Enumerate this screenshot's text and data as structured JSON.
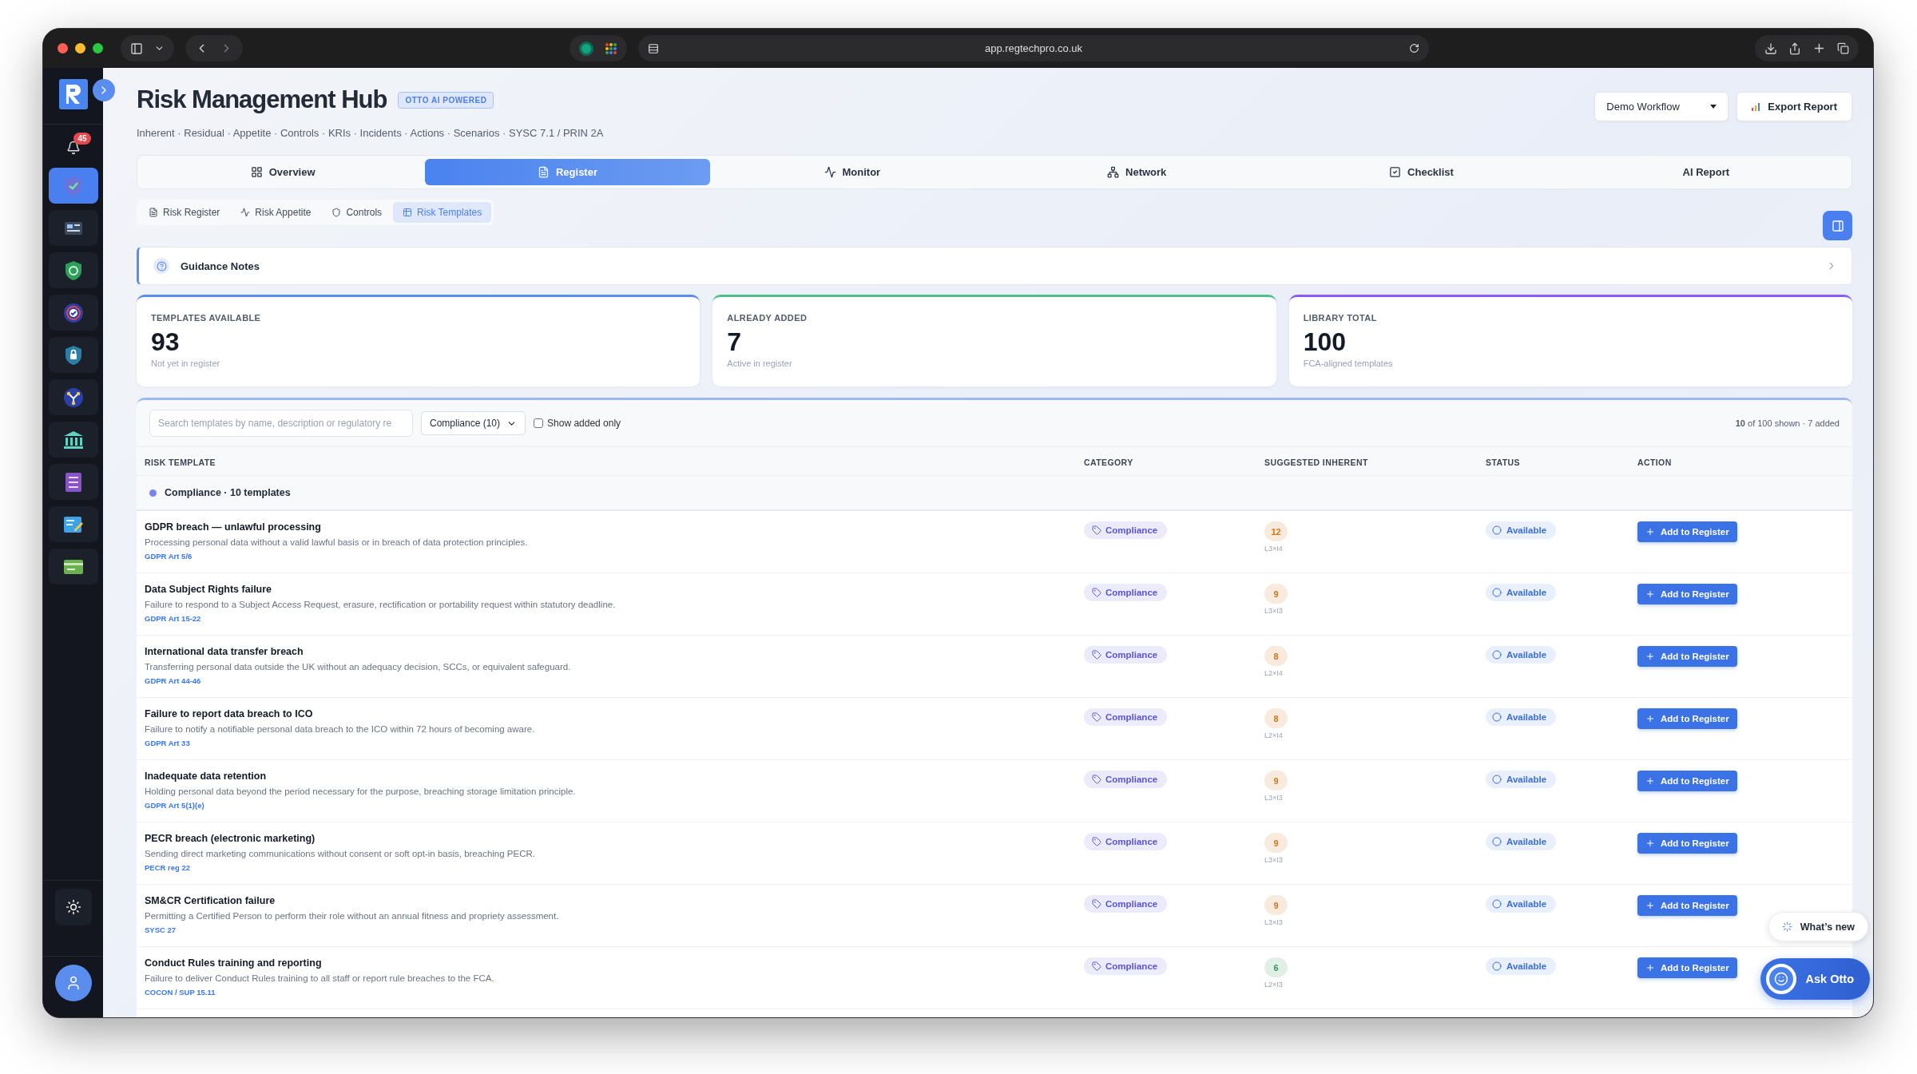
{
  "browser": {
    "url": "app.regtechpro.co.uk"
  },
  "sidebar": {
    "notifications": "45",
    "items": [
      {
        "kind": "shield",
        "selected": true
      },
      {
        "kind": "news",
        "selected": false
      },
      {
        "kind": "greenshield",
        "selected": false
      },
      {
        "kind": "target",
        "selected": false
      },
      {
        "kind": "lock",
        "selected": false
      },
      {
        "kind": "network",
        "selected": false
      },
      {
        "kind": "bank",
        "selected": false
      },
      {
        "kind": "list",
        "selected": false
      },
      {
        "kind": "edit",
        "selected": false
      },
      {
        "kind": "card",
        "selected": false
      }
    ]
  },
  "header": {
    "title": "Risk Management Hub",
    "badge": "OTTO AI POWERED",
    "subtitle": "Inherent · Residual · Appetite · Controls · KRIs · Incidents · Actions · Scenarios · SYSC 7.1 / PRIN 2A",
    "workflow": "Demo Workflow",
    "export": "Export Report"
  },
  "tabs": [
    {
      "label": "Overview",
      "kind": "grid",
      "selected": false
    },
    {
      "label": "Register",
      "kind": "file",
      "selected": true
    },
    {
      "label": "Monitor",
      "kind": "pulse",
      "selected": false
    },
    {
      "label": "Network",
      "kind": "network",
      "selected": false
    },
    {
      "label": "Checklist",
      "kind": "check",
      "selected": false
    },
    {
      "label": "AI Report",
      "kind": "plain",
      "selected": false
    }
  ],
  "subtabs": [
    {
      "label": "Risk Register",
      "kind": "file",
      "selected": false
    },
    {
      "label": "Risk Appetite",
      "kind": "pulse",
      "selected": false
    },
    {
      "label": "Controls",
      "kind": "shield",
      "selected": false
    },
    {
      "label": "Risk Templates",
      "kind": "table",
      "selected": true
    }
  ],
  "guidance": {
    "title": "Guidance Notes"
  },
  "stats": [
    {
      "label": "TEMPLATES AVAILABLE",
      "value": "93",
      "note": "Not yet in register",
      "color": "#5b8def"
    },
    {
      "label": "ALREADY ADDED",
      "value": "7",
      "note": "Active in register",
      "color": "#4fbf8a"
    },
    {
      "label": "LIBRARY TOTAL",
      "value": "100",
      "note": "FCA-aligned templates",
      "color": "#8b5cf6"
    }
  ],
  "toolbar": {
    "search_placeholder": "Search templates by name, description or regulatory re",
    "filter": "Compliance (10)",
    "show_added_only": {
      "label": "Show added only",
      "checked": false
    },
    "count_bold": "10",
    "count_rest": "of 100 shown · 7 added"
  },
  "table": {
    "columns": [
      "RISK TEMPLATE",
      "CATEGORY",
      "SUGGESTED INHERENT",
      "STATUS",
      "ACTION"
    ],
    "group": {
      "label": "Compliance · 10 templates",
      "color": "#7c83f0"
    },
    "rows": [
      {
        "title": "GDPR breach — unlawful processing",
        "description": "Processing personal data without a valid lawful basis or in breach of data protection principles.",
        "reference": "GDPR Art 5/6",
        "category": "Compliance",
        "score": "12",
        "color": "#d2761a",
        "formula": "L3×I4",
        "status": "Available",
        "action": "Add to Register"
      },
      {
        "title": "Data Subject Rights failure",
        "description": "Failure to respond to a Subject Access Request, erasure, rectification or portability request within statutory deadline.",
        "reference": "GDPR Art 15-22",
        "category": "Compliance",
        "score": "9",
        "color": "#d2761a",
        "formula": "L3×I3",
        "status": "Available",
        "action": "Add to Register"
      },
      {
        "title": "International data transfer breach",
        "description": "Transferring personal data outside the UK without an adequacy decision, SCCs, or equivalent safeguard.",
        "reference": "GDPR Art 44-46",
        "category": "Compliance",
        "score": "8",
        "color": "#d2761a",
        "formula": "L2×I4",
        "status": "Available",
        "action": "Add to Register"
      },
      {
        "title": "Failure to report data breach to ICO",
        "description": "Failure to notify a notifiable personal data breach to the ICO within 72 hours of becoming aware.",
        "reference": "GDPR Art 33",
        "category": "Compliance",
        "score": "8",
        "color": "#d2761a",
        "formula": "L2×I4",
        "status": "Available",
        "action": "Add to Register"
      },
      {
        "title": "Inadequate data retention",
        "description": "Holding personal data beyond the period necessary for the purpose, breaching storage limitation principle.",
        "reference": "GDPR Art 5(1)(e)",
        "category": "Compliance",
        "score": "9",
        "color": "#d2761a",
        "formula": "L3×I3",
        "status": "Available",
        "action": "Add to Register"
      },
      {
        "title": "PECR breach (electronic marketing)",
        "description": "Sending direct marketing communications without consent or soft opt-in basis, breaching PECR.",
        "reference": "PECR reg 22",
        "category": "Compliance",
        "score": "9",
        "color": "#d2761a",
        "formula": "L3×I3",
        "status": "Available",
        "action": "Add to Register"
      },
      {
        "title": "SM&CR Certification failure",
        "description": "Permitting a Certified Person to perform their role without an annual fitness and propriety assessment.",
        "reference": "SYSC 27",
        "category": "Compliance",
        "score": "9",
        "color": "#d2761a",
        "formula": "L3×I3",
        "status": "Available",
        "action": "Add to Register"
      },
      {
        "title": "Conduct Rules training and reporting",
        "description": "Failure to deliver Conduct Rules training to all staff or report rule breaches to the FCA.",
        "reference": "COCON / SUP 15.11",
        "category": "Compliance",
        "score": "6",
        "color": "#2f9a5c",
        "formula": "L2×I3",
        "status": "Available",
        "action": "Add to Register"
      }
    ]
  },
  "floating": {
    "whats_new": "What’s new",
    "ask": "Ask Otto"
  }
}
